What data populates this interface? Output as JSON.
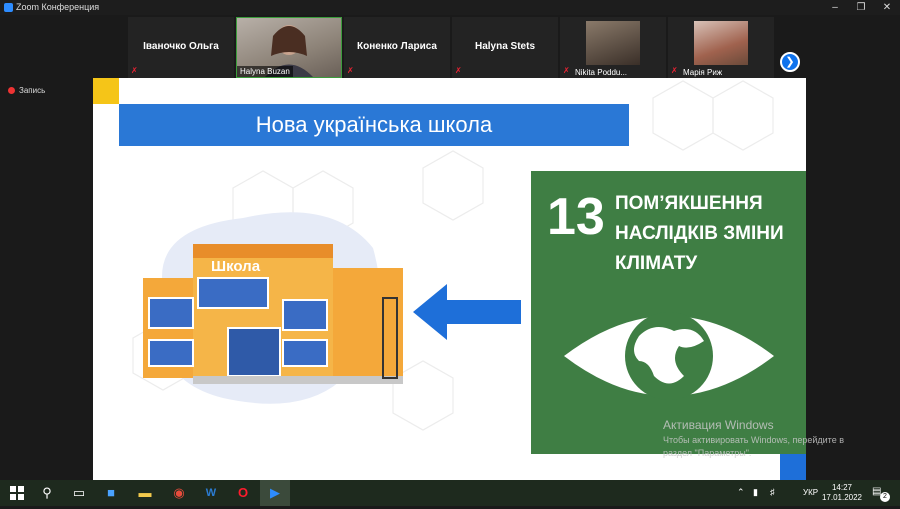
{
  "window": {
    "title": "Zoom Конференция"
  },
  "participants": [
    {
      "name": "Іваночко Ольга",
      "video": false
    },
    {
      "name": "Halyna Buzan",
      "video": true
    },
    {
      "name": "Коненко Лариса",
      "video": false
    },
    {
      "name": "Halyna Stets",
      "video": false
    },
    {
      "name": "Nikita Poddu...",
      "video": true
    },
    {
      "name": "Марія Риж",
      "video": true
    }
  ],
  "recording": {
    "label": "Запись"
  },
  "slide": {
    "title": "Нова українська школа",
    "school_sign": "Школа",
    "goal_number": "13",
    "goal_line1": "ПОМ’ЯКШЕННЯ",
    "goal_line2": "НАСЛІДКІВ ЗМІНИ",
    "goal_line3": "КЛІМАТУ"
  },
  "activation": {
    "title": "Активация Windows",
    "line1": "Чтобы активировать Windows, перейдите в",
    "line2": "раздел \"Параметры\"."
  },
  "taskbar": {
    "lang": "УКР",
    "time": "14:27",
    "date": "17.01.2022",
    "notifications": "2"
  },
  "colors": {
    "banner": "#2a78d6",
    "goal_green": "#3f7e44",
    "accent_yellow": "#f5c518"
  }
}
